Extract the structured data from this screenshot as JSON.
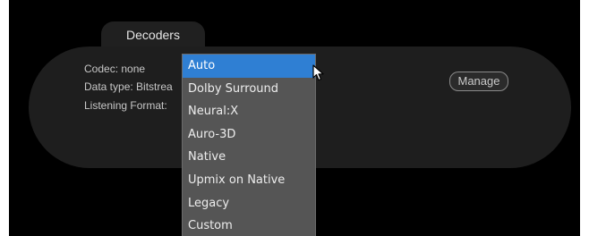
{
  "section_tab": {
    "label": "Decoders"
  },
  "info": {
    "codec": "Codec: none",
    "data_type": "Data type: Bitstrea",
    "listening_format": "Listening Format:"
  },
  "manage_button": {
    "label": "Manage"
  },
  "dropdown": {
    "selected_value": "Auto",
    "options": [
      "Auto",
      "Dolby Surround",
      "Neural:X",
      "Auro-3D",
      "Native",
      "Upmix on Native",
      "Legacy",
      "Custom"
    ]
  },
  "colors": {
    "background": "#000000",
    "panel": "#1e1e1e",
    "dropdown": "#555555",
    "selected_highlight": "#2f7fd3"
  }
}
